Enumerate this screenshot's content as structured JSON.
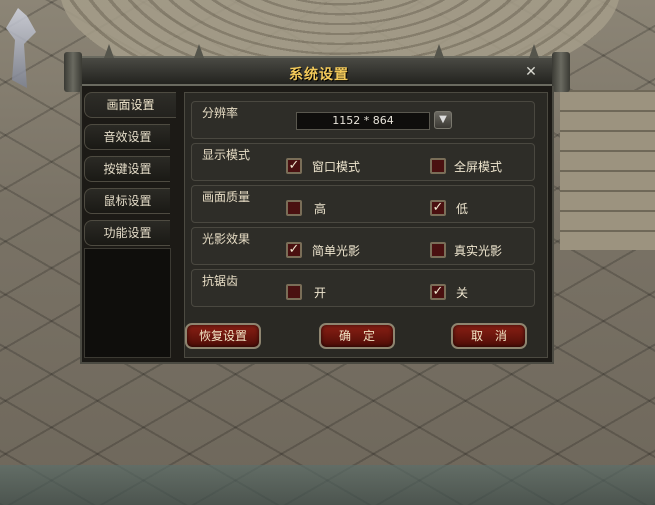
{
  "dialog": {
    "title": "系统设置",
    "close_icon": "close-icon"
  },
  "tabs": [
    {
      "label": "画面设置",
      "active": true
    },
    {
      "label": "音效设置",
      "active": false
    },
    {
      "label": "按键设置",
      "active": false
    },
    {
      "label": "鼠标设置",
      "active": false
    },
    {
      "label": "功能设置",
      "active": false
    }
  ],
  "settings": {
    "resolution": {
      "label": "分辨率",
      "value": "1152 * 864",
      "arrow_icon": "chevron-down-icon"
    },
    "display_mode": {
      "label": "显示模式",
      "options": [
        {
          "label": "窗口模式",
          "checked": true
        },
        {
          "label": "全屏模式",
          "checked": false
        }
      ]
    },
    "quality": {
      "label": "画面质量",
      "options": [
        {
          "label": "高",
          "checked": false
        },
        {
          "label": "低",
          "checked": true
        }
      ]
    },
    "lighting": {
      "label": "光影效果",
      "options": [
        {
          "label": "简单光影",
          "checked": true
        },
        {
          "label": "真实光影",
          "checked": false
        }
      ]
    },
    "antialias": {
      "label": "抗锯齿",
      "options": [
        {
          "label": "开",
          "checked": false
        },
        {
          "label": "关",
          "checked": true
        }
      ]
    }
  },
  "buttons": {
    "restore": "恢复设置",
    "confirm": "确　定",
    "cancel": "取　消"
  },
  "check_mark": "✓",
  "colors": {
    "title": "#f2c95a",
    "button_red": "#8a1f14",
    "checkbox_fill": "#4a1010"
  }
}
